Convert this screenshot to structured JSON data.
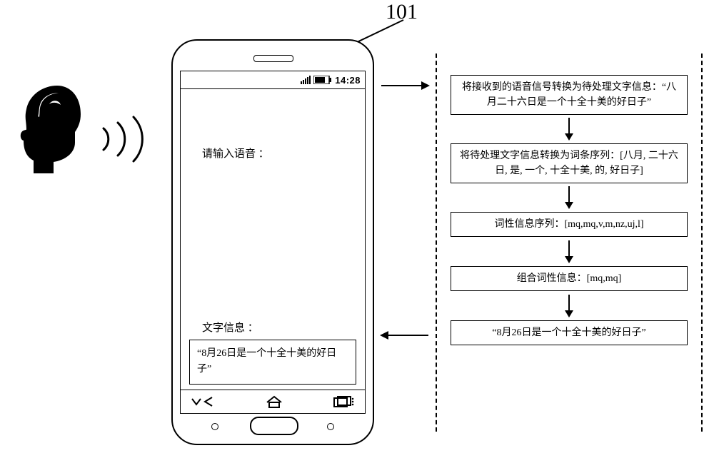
{
  "callout": {
    "label": "101"
  },
  "phone": {
    "status_bar": {
      "time": "14:28"
    },
    "prompt_voice_label": "请输入语音 ：",
    "text_info_label": "文字信息 ：",
    "result_text": "“8月26日是一个十全十美的好日子”"
  },
  "flow": {
    "steps": [
      "将接收到的语音信号转换为待处理文字信息：“八月二十六日是一个十全十美的好日子”",
      "将待处理文字信息转换为词条序列：[八月, 二十六日, 是, 一个, 十全十美, 的, 好日子]",
      "词性信息序列：[mq,mq,v,m,nz,uj,l]",
      "组合词性信息：[mq,mq]",
      "“8月26日是一个十全十美的好日子”"
    ]
  },
  "icons": {
    "head": "user-head-silhouette",
    "sound": "sound-wave-icon",
    "signal": "signal-icon",
    "battery": "battery-icon",
    "nav_back": "back-icon",
    "nav_home": "home-icon",
    "nav_recent": "recent-apps-icon"
  }
}
